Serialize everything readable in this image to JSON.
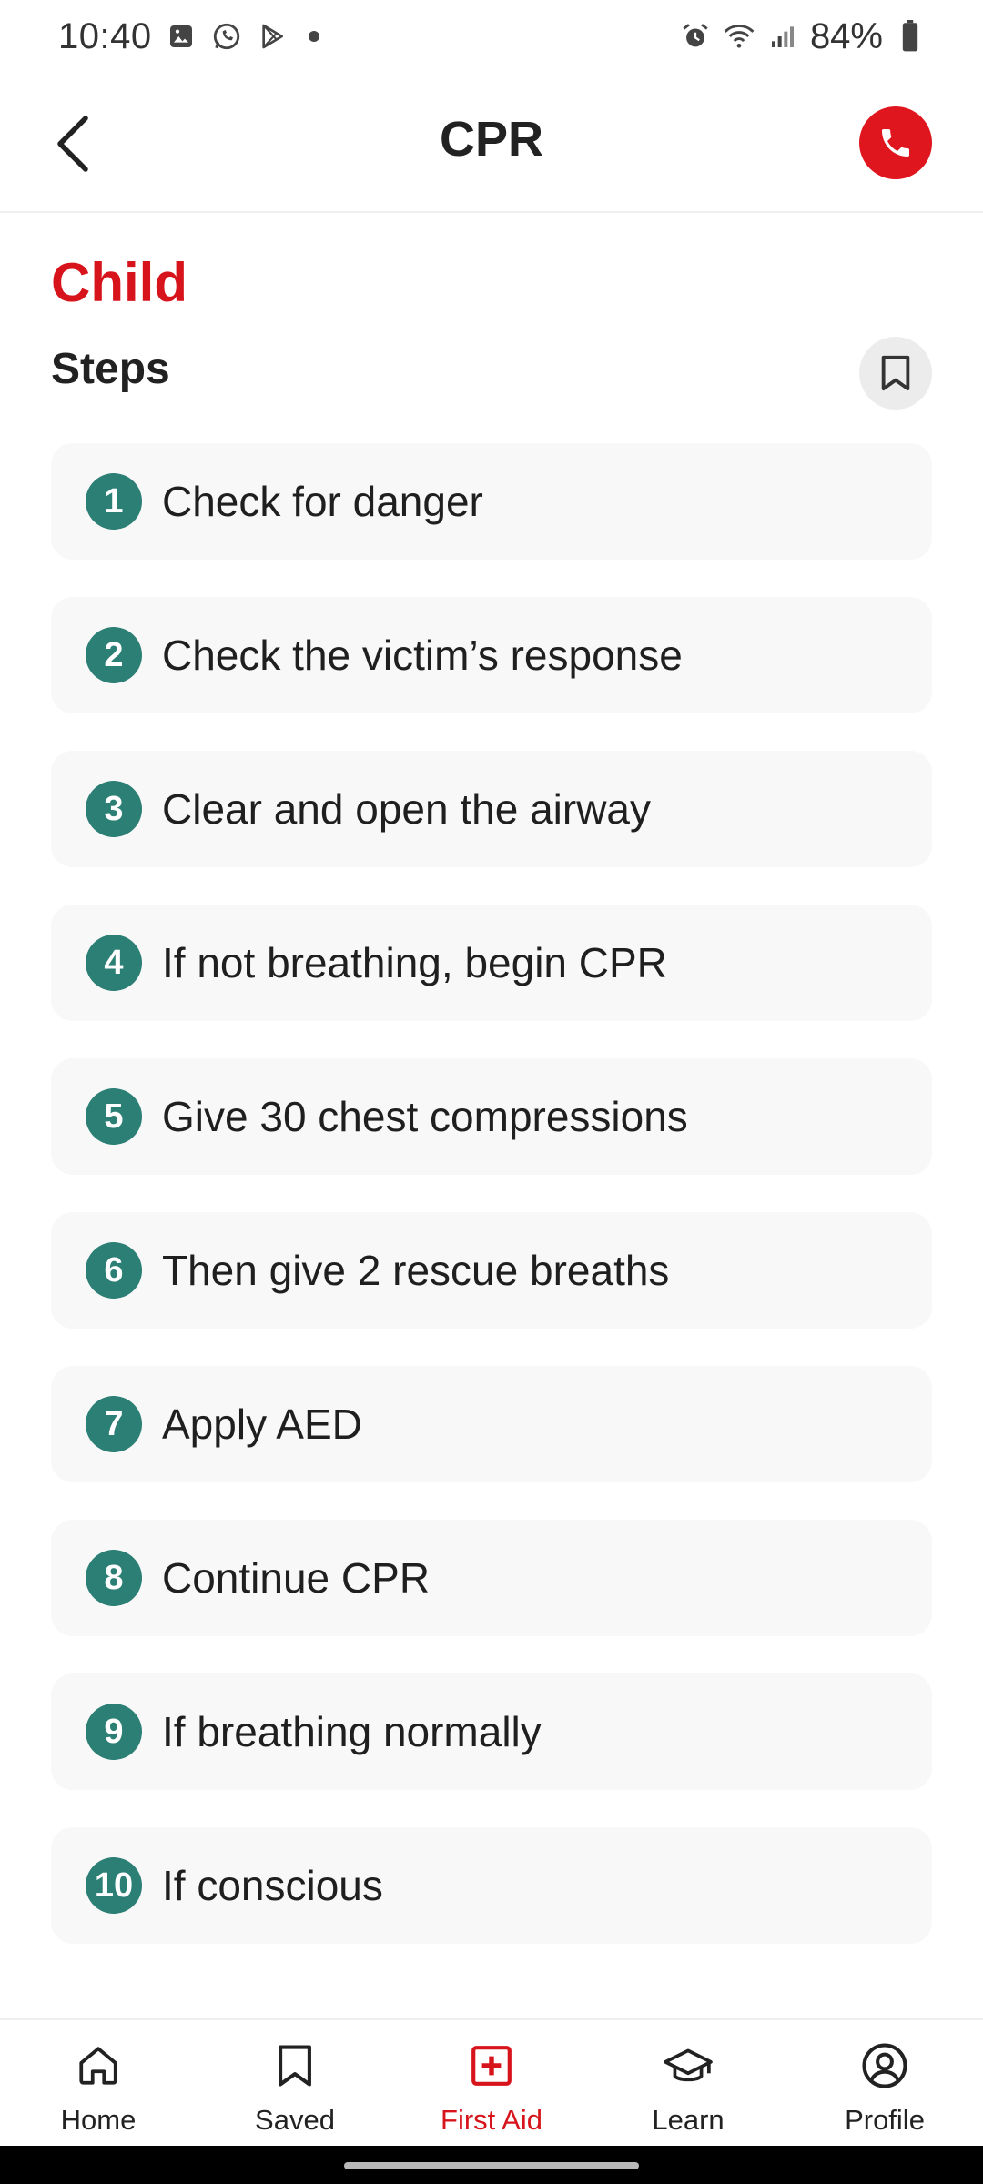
{
  "status_bar": {
    "time": "10:40",
    "battery": "84%",
    "icons": [
      "gallery-icon",
      "whatsapp-icon",
      "play-store-icon",
      "alarm-icon",
      "wifi-icon",
      "signal-icon",
      "battery-icon"
    ]
  },
  "header": {
    "title": "CPR",
    "back_icon": "chevron-left-icon",
    "call_icon": "phone-icon"
  },
  "content": {
    "category": "Child",
    "steps_title": "Steps",
    "steps": [
      {
        "num": "1",
        "label": "Check for danger"
      },
      {
        "num": "2",
        "label": "Check the victim’s response"
      },
      {
        "num": "3",
        "label": "Clear and open the airway"
      },
      {
        "num": "4",
        "label": "If not breathing, begin CPR"
      },
      {
        "num": "5",
        "label": "Give 30 chest compressions"
      },
      {
        "num": "6",
        "label": "Then give 2 rescue breaths"
      },
      {
        "num": "7",
        "label": "Apply AED"
      },
      {
        "num": "8",
        "label": "Continue CPR"
      },
      {
        "num": "9",
        "label": "If breathing normally"
      },
      {
        "num": "10",
        "label": "If conscious"
      }
    ]
  },
  "bottom_nav": {
    "items": [
      {
        "label": "Home",
        "icon": "home-icon"
      },
      {
        "label": "Saved",
        "icon": "bookmark-icon"
      },
      {
        "label": "First Aid",
        "icon": "first-aid-icon",
        "active": true
      },
      {
        "label": "Learn",
        "icon": "graduation-cap-icon"
      },
      {
        "label": "Profile",
        "icon": "user-circle-icon"
      }
    ]
  },
  "colors": {
    "accent_red": "#d7141c",
    "step_badge": "#2b7f75",
    "card_bg": "#f8f8f8"
  }
}
